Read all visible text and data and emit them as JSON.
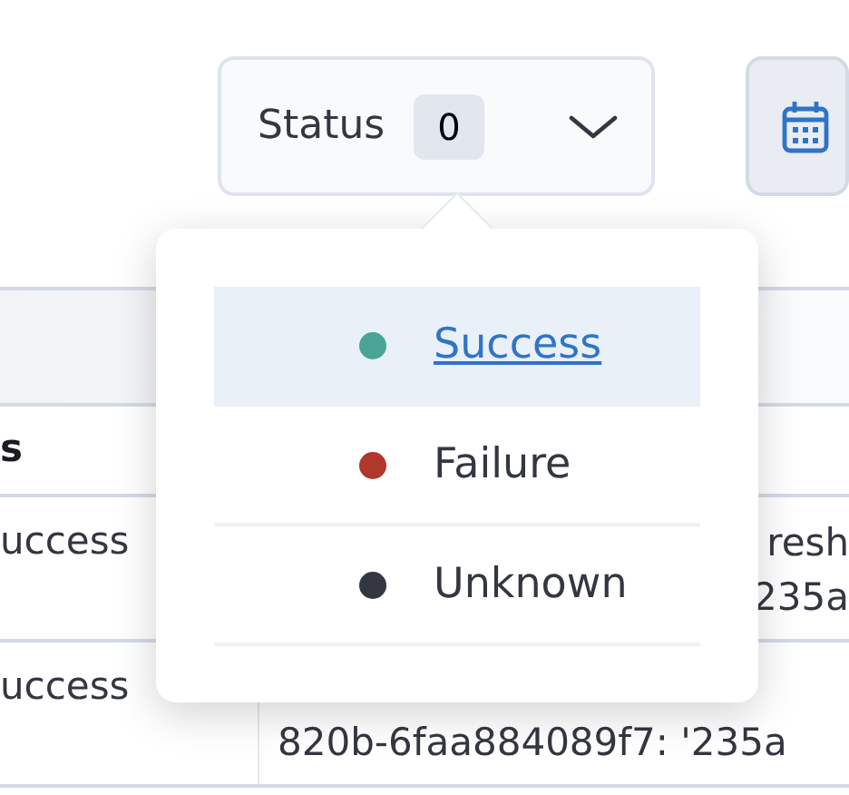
{
  "status_filter": {
    "label": "Status",
    "count": "0"
  },
  "status_options": [
    {
      "label": "Success",
      "color": "#4aa397",
      "selected": true
    },
    {
      "label": "Failure",
      "color": "#b0372b",
      "selected": false
    },
    {
      "label": "Unknown",
      "color": "#343741",
      "selected": false
    }
  ],
  "table": {
    "header": [
      "s"
    ],
    "rows": [
      {
        "column_1": "uccess",
        "column_2": [
          "resh",
          "235a"
        ]
      },
      {
        "column_1": "uccess",
        "column_2": [
          "820b-6faa884089f7: '235a"
        ]
      }
    ]
  }
}
